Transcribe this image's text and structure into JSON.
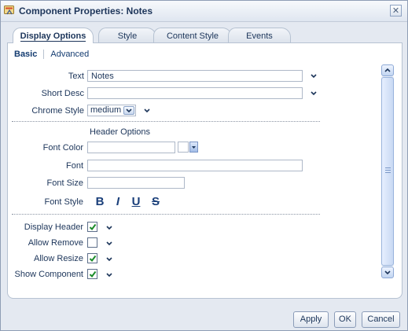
{
  "window": {
    "title": "Component Properties: Notes",
    "close_icon": "close-icon",
    "app_icon": "properties-icon"
  },
  "tabs": [
    {
      "label": "Display Options",
      "active": true
    },
    {
      "label": "Style",
      "active": false
    },
    {
      "label": "Content Style",
      "active": false
    },
    {
      "label": "Events",
      "active": false
    }
  ],
  "subtabs": {
    "basic": "Basic",
    "advanced": "Advanced",
    "active": "Basic"
  },
  "fields": {
    "text": {
      "label": "Text",
      "value": "Notes"
    },
    "short_desc": {
      "label": "Short Desc",
      "value": ""
    },
    "chrome_style": {
      "label": "Chrome Style",
      "value": "medium"
    }
  },
  "header_options": {
    "title": "Header Options",
    "font_color": {
      "label": "Font Color",
      "value": ""
    },
    "font": {
      "label": "Font",
      "value": ""
    },
    "font_size": {
      "label": "Font Size",
      "value": ""
    },
    "font_style": {
      "label": "Font Style",
      "bold": "B",
      "italic": "I",
      "underline": "U",
      "strikethrough": "S"
    }
  },
  "checkboxes": [
    {
      "label": "Display Header",
      "checked": true
    },
    {
      "label": "Allow Remove",
      "checked": false
    },
    {
      "label": "Allow Resize",
      "checked": true
    },
    {
      "label": "Show Component",
      "checked": true
    }
  ],
  "buttons": {
    "apply": "Apply",
    "ok": "OK",
    "cancel": "Cancel"
  },
  "colors": {
    "accent": "#1a3f7a",
    "check": "#1b8c2a",
    "panel": "#ffffff",
    "dialog": "#e4e9f1"
  }
}
